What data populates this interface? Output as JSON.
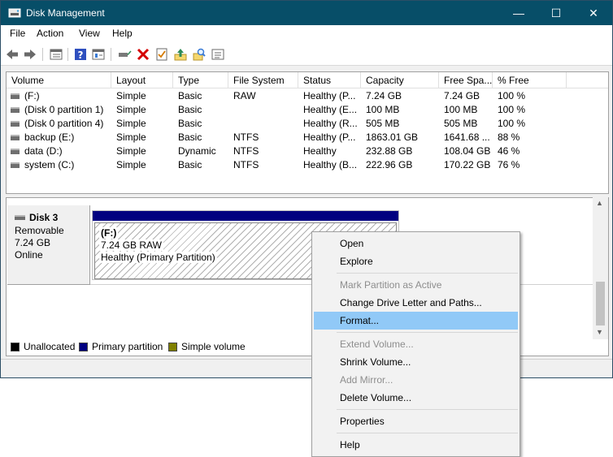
{
  "window": {
    "title": "Disk Management",
    "titlebar_color": "#074e68",
    "minimize_glyph": "—",
    "maximize_glyph": "☐",
    "close_glyph": "✕"
  },
  "menubar": {
    "items": [
      "File",
      "Action",
      "View",
      "Help"
    ]
  },
  "toolbar": {
    "icons": [
      "back-arrow-icon",
      "forward-arrow-icon",
      "disk-list-icon",
      "help-icon",
      "properties-icon",
      "connect-icon",
      "delete-icon",
      "checklist-icon",
      "upload-icon",
      "search-icon",
      "settings-list-icon"
    ]
  },
  "volume_table": {
    "columns": [
      "Volume",
      "Layout",
      "Type",
      "File System",
      "Status",
      "Capacity",
      "Free Spa...",
      "% Free"
    ],
    "rows": [
      [
        "(F:)",
        "Simple",
        "Basic",
        "RAW",
        "Healthy (P...",
        "7.24 GB",
        "7.24 GB",
        "100 %"
      ],
      [
        "(Disk 0 partition 1)",
        "Simple",
        "Basic",
        "",
        "Healthy (E...",
        "100 MB",
        "100 MB",
        "100 %"
      ],
      [
        "(Disk 0 partition 4)",
        "Simple",
        "Basic",
        "",
        "Healthy (R...",
        "505 MB",
        "505 MB",
        "100 %"
      ],
      [
        "backup (E:)",
        "Simple",
        "Basic",
        "NTFS",
        "Healthy (P...",
        "1863.01 GB",
        "1641.68 ...",
        "88 %"
      ],
      [
        "data (D:)",
        "Simple",
        "Dynamic",
        "NTFS",
        "Healthy",
        "232.88 GB",
        "108.04 GB",
        "46 %"
      ],
      [
        "system (C:)",
        "Simple",
        "Basic",
        "NTFS",
        "Healthy (B...",
        "222.96 GB",
        "170.22 GB",
        "76 %"
      ]
    ]
  },
  "disk": {
    "name": "Disk 3",
    "kind": "Removable",
    "size": "7.24 GB",
    "state": "Online",
    "partition": {
      "label": "(F:)",
      "size_fs": "7.24 GB RAW",
      "status": "Healthy (Primary Partition)",
      "bar_color": "#000080"
    }
  },
  "legend": {
    "items": [
      {
        "label": "Unallocated",
        "color": "#000000"
      },
      {
        "label": "Primary partition",
        "color": "#000080"
      },
      {
        "label": "Simple volume",
        "color": "#808000"
      }
    ]
  },
  "context_menu": {
    "highlight_color": "#91c9f7",
    "items": [
      {
        "label": "Open",
        "disabled": false
      },
      {
        "label": "Explore",
        "disabled": false
      },
      {
        "label": "Mark Partition as Active",
        "disabled": true
      },
      {
        "label": "Change Drive Letter and Paths...",
        "disabled": false
      },
      {
        "label": "Format...",
        "disabled": false,
        "highlighted": true
      },
      {
        "label": "Extend Volume...",
        "disabled": true
      },
      {
        "label": "Shrink Volume...",
        "disabled": false
      },
      {
        "label": "Add Mirror...",
        "disabled": true
      },
      {
        "label": "Delete Volume...",
        "disabled": false
      },
      {
        "label": "Properties",
        "disabled": false
      },
      {
        "label": "Help",
        "disabled": false
      }
    ]
  }
}
